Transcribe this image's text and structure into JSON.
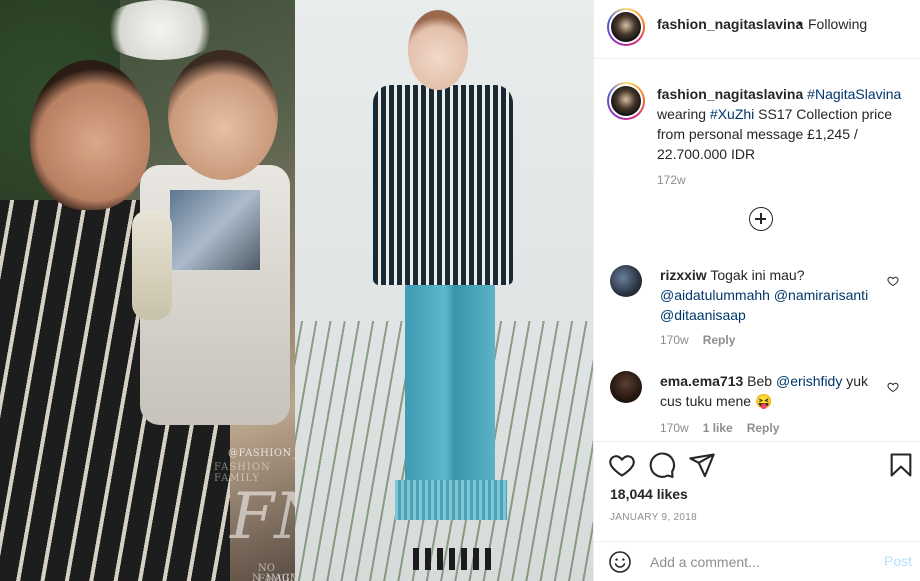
{
  "post": {
    "author": "fashion_nagitaslavina",
    "follow_status": "Following",
    "separator": "•",
    "caption": {
      "username": "fashion_nagitaslavina",
      "hashtag1": "#NagitaSlavina",
      "text1": " wearing ",
      "hashtag2": "#XuZhi",
      "text2": " SS17 Collection price from personal message £1,245 / 22.700.000 IDR",
      "time": "172w"
    },
    "comments": [
      {
        "username": "rizxxiw",
        "text": " Togak ini mau? ",
        "mentions": [
          "@aidatulummahh",
          "@namirarisanti",
          "@ditaanisaap"
        ],
        "time": "170w",
        "reply_label": "Reply"
      },
      {
        "username": "ema.ema713",
        "text_before": " Beb ",
        "mention": "@erishfidy",
        "text_after": " yuk cus tuku mene 😝",
        "time": "170w",
        "likes_label": "1 like",
        "reply_label": "Reply"
      }
    ],
    "likes": "18,044 likes",
    "date": "JANUARY 9, 2018",
    "comment_input": {
      "placeholder": "Add a comment...",
      "post_label": "Post"
    }
  },
  "photo": {
    "watermark_top": "@FASHION_NAGITASLAVI",
    "watermark_family": "FASHION FAMILY",
    "logo_mark": "FN",
    "watermark_bottom1": "NO FAMILY",
    "watermark_bottom2": "N_NAGITASLAVINA"
  },
  "colors": {
    "link": "#00376b",
    "secondary_text": "#8e8e8e",
    "post_disabled": "#b2dffc",
    "border": "#efefef"
  },
  "icons": [
    "heart-icon",
    "comment-icon",
    "share-icon",
    "bookmark-icon",
    "emoji-icon",
    "plus-circle-icon"
  ]
}
